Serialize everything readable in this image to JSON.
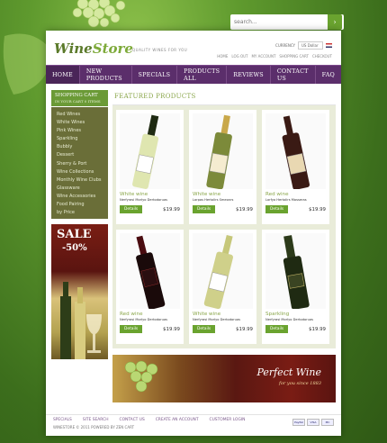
{
  "search": {
    "placeholder": "search..."
  },
  "header": {
    "logo_main": "Wine",
    "logo_accent": "Store",
    "tagline": "QUALITY WINES FOR YOU",
    "currency_label": "CURRENCY",
    "currency_value": "US Dollar",
    "toplinks": [
      "HOME",
      "LOG OUT",
      "MY ACCOUNT",
      "SHOPPING CART",
      "CHECKOUT"
    ]
  },
  "nav": [
    "HOME",
    "NEW PRODUCTS",
    "SPECIALS",
    "PRODUCTS ALL",
    "REVIEWS",
    "CONTACT US",
    "FAQ"
  ],
  "sidebar": {
    "cart_title": "SHOPPING CART",
    "cart_status": "IN YOUR CART 0 ITEMS",
    "categories": [
      "Red Wines",
      "White Wines",
      "Pink Wines",
      "Sparkling",
      "Bubbly",
      "Dessert",
      "Sherry & Port",
      "Wine Collections",
      "Monthly Wine Clubs",
      "Glassware",
      "Wine Accessories",
      "Food Pairing",
      "by Price"
    ],
    "sale_title": "SALE",
    "sale_discount": "-50%"
  },
  "featured": {
    "heading": "FEATURED PRODUCTS",
    "products": [
      {
        "name": "White wine",
        "desc": "Nerfyrasi Morlyo Dertodoruas",
        "price": "$19.99",
        "button": "Details"
      },
      {
        "name": "White wine",
        "desc": "Lorpas Hertolirs Smeonrs",
        "price": "$19.99",
        "button": "Details"
      },
      {
        "name": "Red wine",
        "desc": "Lorfyo Hertolirs Mosseras",
        "price": "$19.99",
        "button": "Details"
      },
      {
        "name": "Red wine",
        "desc": "Nerfyrasi Morlyo Dertodoruas",
        "price": "$19.99",
        "button": "Details"
      },
      {
        "name": "White wine",
        "desc": "Nerfyrasi Morlyo Dertodoruas",
        "price": "$19.99",
        "button": "Details"
      },
      {
        "name": "Sparkling",
        "desc": "Nerfyrasi Morlyo Dertodoruas",
        "price": "$19.99",
        "button": "Details"
      }
    ]
  },
  "banner": {
    "title": "Perfect Wine",
    "since": "for you since 1883"
  },
  "footer": {
    "links": [
      "SPECIALS",
      "SITE SEARCH",
      "CONTACT US",
      "CREATE AN ACCOUNT",
      "CUSTOMER LOGIN"
    ],
    "copyright": "WINESTORE © 2011 POWERED BY ZEN CART",
    "payments": [
      "PayPal",
      "VISA",
      "MC"
    ]
  },
  "colors": {
    "nav": "#5b2e6b",
    "accent": "#6aa32f",
    "sidebar": "#6a6e38"
  }
}
